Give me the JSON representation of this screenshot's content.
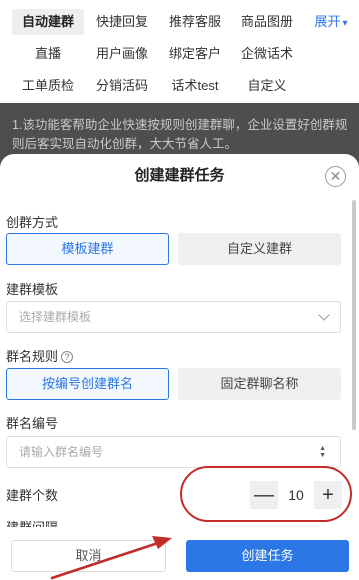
{
  "tabs": {
    "row1": [
      "自动建群",
      "快捷回复",
      "推荐客服",
      "商品图册"
    ],
    "expand_label": "展开",
    "row2": [
      "直播",
      "用户画像",
      "绑定客户",
      "企微话术"
    ],
    "row3": [
      "工单质检",
      "分销活码",
      "话术test",
      "自定义"
    ]
  },
  "background_description": "1.该功能客帮助企业快速按规则创建群聊，企业设置好创群规则后客实现自动化创群，大大节省人工。",
  "dialog": {
    "title": "创建建群任务",
    "close_icon": "close-circle-icon",
    "mode": {
      "label": "创群方式",
      "options": [
        "模板建群",
        "自定义建群"
      ],
      "selected": "模板建群"
    },
    "template": {
      "label": "建群模板",
      "placeholder": "选择建群模板"
    },
    "naming_rule": {
      "label": "群名规则",
      "help_icon": "?",
      "options": [
        "按编号创建群名",
        "固定群聊名称"
      ],
      "selected": "按编号创建群名"
    },
    "group_number": {
      "label": "群名编号",
      "placeholder": "请输入群名编号"
    },
    "group_count": {
      "label": "建群个数",
      "value": "10",
      "minus": "—",
      "plus": "+"
    },
    "partial_label": "建群间隔",
    "cancel_label": "取消",
    "submit_label": "创建任务"
  },
  "colors": {
    "accent": "#2b77e6",
    "annotation": "#c42b2b",
    "mask": "#4e4e4e"
  }
}
